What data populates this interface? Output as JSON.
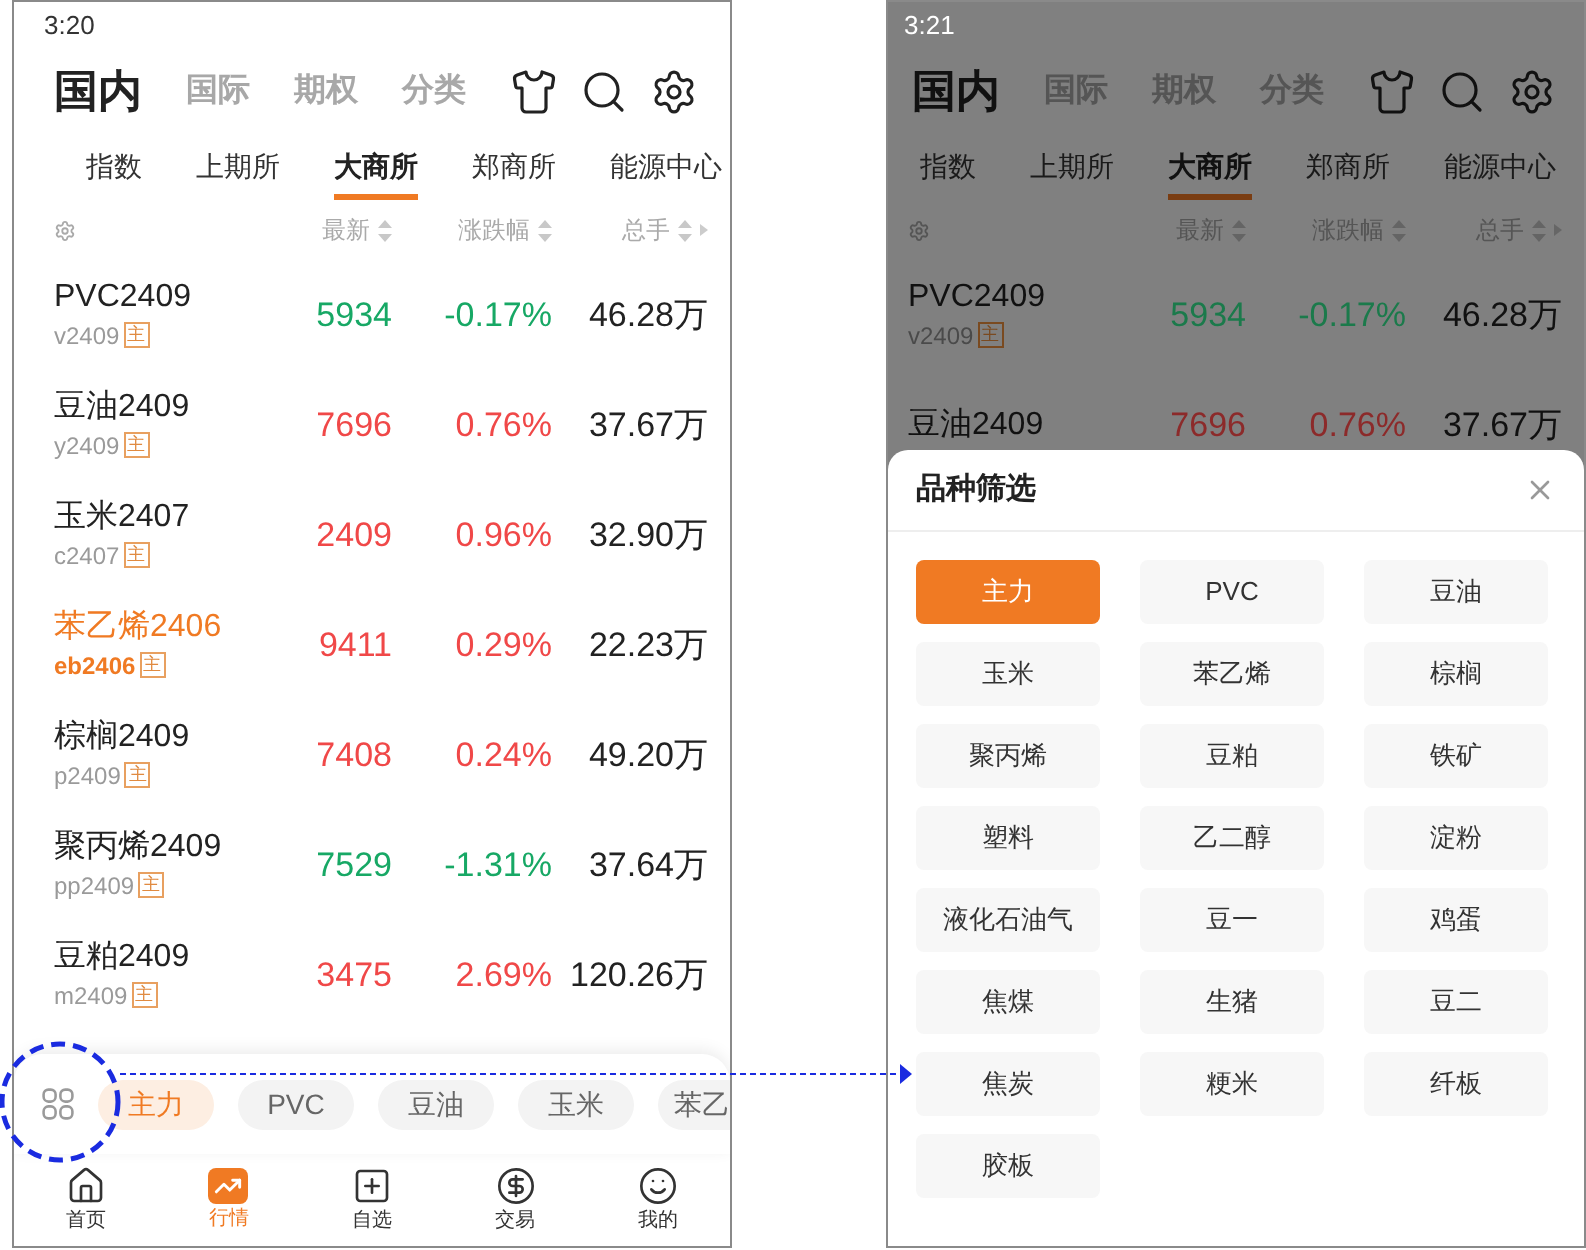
{
  "screens": [
    {
      "status_time": "3:20",
      "top_tabs": [
        {
          "label": "国内",
          "selected": true
        },
        {
          "label": "国际",
          "selected": false
        },
        {
          "label": "期权",
          "selected": false
        },
        {
          "label": "分类",
          "selected": false
        }
      ],
      "exchange_tabs": [
        {
          "label": "指数",
          "selected": false
        },
        {
          "label": "上期所",
          "selected": false
        },
        {
          "label": "大商所",
          "selected": true
        },
        {
          "label": "郑商所",
          "selected": false
        },
        {
          "label": "能源中心",
          "selected": false
        }
      ],
      "columns": [
        "最新",
        "涨跌幅",
        "总手"
      ],
      "rows": [
        {
          "name": "PVC2409",
          "code": "v2409",
          "badge": "主",
          "last": "5934",
          "change": "-0.17%",
          "volume": "46.28万",
          "color": "#17a865",
          "selected": false
        },
        {
          "name": "豆油2409",
          "code": "y2409",
          "badge": "主",
          "last": "7696",
          "change": "0.76%",
          "volume": "37.67万",
          "color": "#f04848",
          "selected": false
        },
        {
          "name": "玉米2407",
          "code": "c2407",
          "badge": "主",
          "last": "2409",
          "change": "0.96%",
          "volume": "32.90万",
          "color": "#f04848",
          "selected": false
        },
        {
          "name": "苯乙烯2406",
          "code": "eb2406",
          "badge": "主",
          "last": "9411",
          "change": "0.29%",
          "volume": "22.23万",
          "color": "#f04848",
          "selected": true
        },
        {
          "name": "棕榈2409",
          "code": "p2409",
          "badge": "主",
          "last": "7408",
          "change": "0.24%",
          "volume": "49.20万",
          "color": "#f04848",
          "selected": false
        },
        {
          "name": "聚丙烯2409",
          "code": "pp2409",
          "badge": "主",
          "last": "7529",
          "change": "-1.31%",
          "volume": "37.64万",
          "color": "#17a865",
          "selected": false
        },
        {
          "name": "豆粕2409",
          "code": "m2409",
          "badge": "主",
          "last": "3475",
          "change": "2.69%",
          "volume": "120.26万",
          "color": "#f04848",
          "selected": false
        }
      ],
      "quick_filter": [
        {
          "label": "主力",
          "selected": true
        },
        {
          "label": "PVC",
          "selected": false
        },
        {
          "label": "豆油",
          "selected": false
        },
        {
          "label": "玉米",
          "selected": false
        },
        {
          "label": "苯乙",
          "selected": false
        }
      ],
      "bottom_nav": [
        {
          "label": "首页",
          "selected": false
        },
        {
          "label": "行情",
          "selected": true
        },
        {
          "label": "自选",
          "selected": false
        },
        {
          "label": "交易",
          "selected": false
        },
        {
          "label": "我的",
          "selected": false
        }
      ]
    },
    {
      "status_time": "3:21",
      "top_tabs": [
        {
          "label": "国内",
          "selected": true
        },
        {
          "label": "国际",
          "selected": false
        },
        {
          "label": "期权",
          "selected": false
        },
        {
          "label": "分类",
          "selected": false
        }
      ],
      "exchange_tabs": [
        {
          "label": "指数",
          "selected": false
        },
        {
          "label": "上期所",
          "selected": false
        },
        {
          "label": "大商所",
          "selected": true
        },
        {
          "label": "郑商所",
          "selected": false
        },
        {
          "label": "能源中心",
          "selected": false
        }
      ],
      "columns": [
        "最新",
        "涨跌幅",
        "总手"
      ],
      "rows": [
        {
          "name": "PVC2409",
          "code": "v2409",
          "badge": "主",
          "last": "5934",
          "change": "-0.17%",
          "volume": "46.28万",
          "color": "#1b7a4b",
          "selected": false
        },
        {
          "name": "豆油2409",
          "last": "7696",
          "change": "0.76%",
          "volume": "37.67万",
          "color": "#8c2a2a",
          "selected": false
        }
      ],
      "filter_sheet": {
        "title": "品种筛选",
        "options": [
          {
            "label": "主力",
            "selected": true
          },
          {
            "label": "PVC",
            "selected": false
          },
          {
            "label": "豆油",
            "selected": false
          },
          {
            "label": "玉米",
            "selected": false
          },
          {
            "label": "苯乙烯",
            "selected": false
          },
          {
            "label": "棕榈",
            "selected": false
          },
          {
            "label": "聚丙烯",
            "selected": false
          },
          {
            "label": "豆粕",
            "selected": false
          },
          {
            "label": "铁矿",
            "selected": false
          },
          {
            "label": "塑料",
            "selected": false
          },
          {
            "label": "乙二醇",
            "selected": false
          },
          {
            "label": "淀粉",
            "selected": false
          },
          {
            "label": "液化石油气",
            "selected": false
          },
          {
            "label": "豆一",
            "selected": false
          },
          {
            "label": "鸡蛋",
            "selected": false
          },
          {
            "label": "焦煤",
            "selected": false
          },
          {
            "label": "生猪",
            "selected": false
          },
          {
            "label": "豆二",
            "selected": false
          },
          {
            "label": "焦炭",
            "selected": false
          },
          {
            "label": "粳米",
            "selected": false
          },
          {
            "label": "纤板",
            "selected": false
          },
          {
            "label": "胶板",
            "selected": false
          }
        ]
      }
    }
  ]
}
